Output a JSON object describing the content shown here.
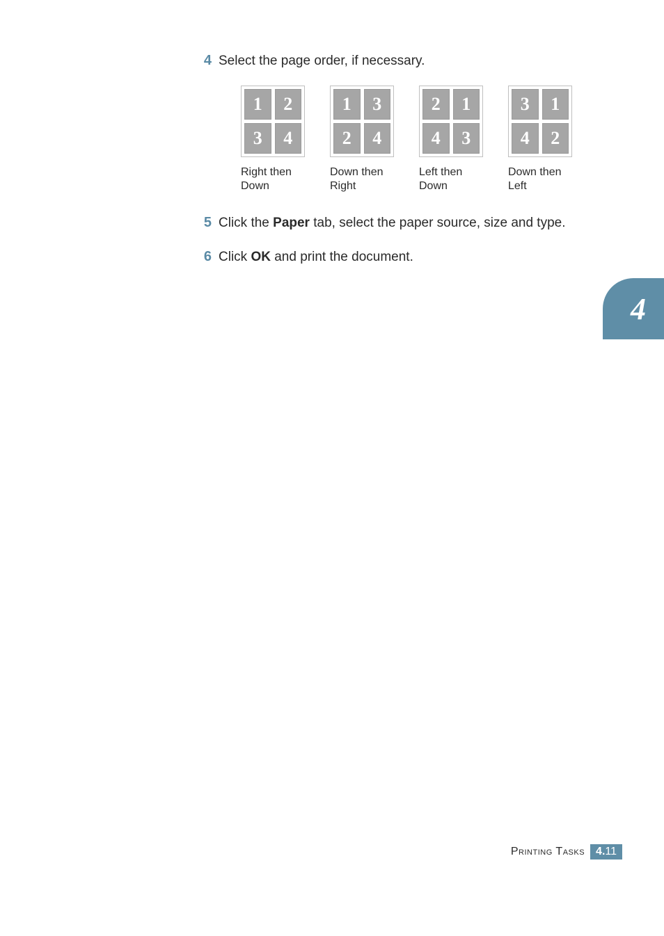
{
  "steps": [
    {
      "num": "4",
      "before": "Select the page order, if necessary.",
      "bold": "",
      "after": ""
    },
    {
      "num": "5",
      "before": "Click the ",
      "bold": "Paper",
      "after": " tab, select the paper source, size and type."
    },
    {
      "num": "6",
      "before": "Click ",
      "bold": "OK",
      "after": " and print the document."
    }
  ],
  "orderOptions": [
    {
      "cells": [
        "1",
        "2",
        "3",
        "4"
      ],
      "label": "Right then Down"
    },
    {
      "cells": [
        "1",
        "3",
        "2",
        "4"
      ],
      "label": "Down then Right"
    },
    {
      "cells": [
        "2",
        "1",
        "4",
        "3"
      ],
      "label": "Left then Down"
    },
    {
      "cells": [
        "3",
        "1",
        "4",
        "2"
      ],
      "label": "Down then Left"
    }
  ],
  "sideTab": "4",
  "footer": {
    "title": "Printing Tasks",
    "chapter": "4.",
    "page": "11"
  }
}
